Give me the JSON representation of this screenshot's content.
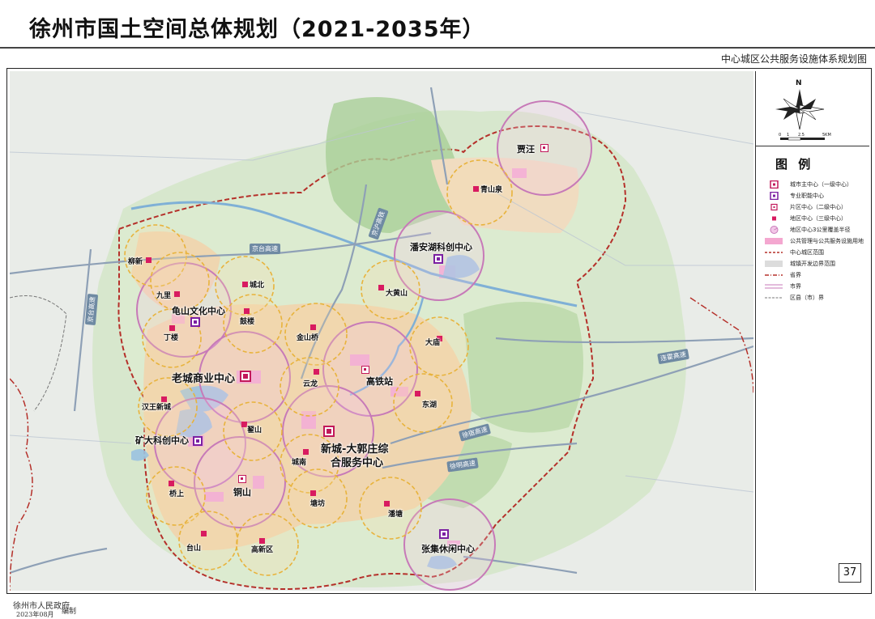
{
  "header": {
    "title": "徐州市国土空间总体规划（2021-2035年）",
    "subtitle": "中心城区公共服务设施体系规划图"
  },
  "compass": {
    "north_label": "N",
    "scale_labels": [
      "0",
      "1",
      "2.5",
      "5KM"
    ]
  },
  "legend": {
    "title": "图  例",
    "items": [
      {
        "label": "城市主中心（一级中心）",
        "icon": "city-main-center-icon"
      },
      {
        "label": "专业职能中心",
        "icon": "function-center-icon"
      },
      {
        "label": "片区中心（二级中心）",
        "icon": "district-center-icon"
      },
      {
        "label": "地区中心（三级中心）",
        "icon": "local-center-icon"
      },
      {
        "label": "地区中心3公里覆盖半径",
        "icon": "coverage-radius-icon"
      },
      {
        "label": "公共管理与公共服务设施用地",
        "icon": "public-land-icon"
      },
      {
        "label": "中心城区范围",
        "icon": "central-boundary-icon"
      },
      {
        "label": "城镇开发边界范围",
        "icon": "dev-boundary-icon"
      },
      {
        "label": "省界",
        "icon": "province-border-icon"
      },
      {
        "label": "市界",
        "icon": "city-border-icon"
      },
      {
        "label": "区县（市）界",
        "icon": "county-border-icon"
      }
    ],
    "colors": {
      "main": "#c2185b",
      "function": "#7b1fa2",
      "local": "#d81b60",
      "coverage": "#c77ab8",
      "public_land": "#f4a7d0",
      "boundary": "#b5302a",
      "dev": "#dcdcdc"
    }
  },
  "map": {
    "main_centers": [
      {
        "label": "老城商业中心"
      },
      {
        "label": "新城-大郭庄综合服务中心",
        "label_line1": "新城-大郭庄综",
        "label_line2": "合服务中心"
      }
    ],
    "function_centers": [
      {
        "label": "潘安湖科创中心"
      },
      {
        "label": "龟山文化中心"
      },
      {
        "label": "矿大科创中心"
      },
      {
        "label": "张集休闲中心"
      }
    ],
    "district_centers": [
      {
        "label": "贾汪"
      },
      {
        "label": "高铁站"
      },
      {
        "label": "铜山"
      }
    ],
    "local_centers": [
      {
        "label": "青山泉"
      },
      {
        "label": "柳新"
      },
      {
        "label": "九里"
      },
      {
        "label": "城北"
      },
      {
        "label": "丁楼"
      },
      {
        "label": "鼓楼"
      },
      {
        "label": "金山桥"
      },
      {
        "label": "大黄山"
      },
      {
        "label": "大庙"
      },
      {
        "label": "云龙"
      },
      {
        "label": "东湖"
      },
      {
        "label": "汉王新城"
      },
      {
        "label": "翟山"
      },
      {
        "label": "城南"
      },
      {
        "label": "桥上"
      },
      {
        "label": "塘坊"
      },
      {
        "label": "潘塘"
      },
      {
        "label": "台山"
      },
      {
        "label": "高新区"
      }
    ],
    "road_labels": [
      "京台高速",
      "京沪高铁",
      "连霍高速",
      "徐宿高速",
      "徐明高速",
      "京台高速"
    ]
  },
  "page_number": "37",
  "footer": {
    "org": "徐州市人民政府",
    "date": "2023年08月",
    "made_by": "编制"
  }
}
